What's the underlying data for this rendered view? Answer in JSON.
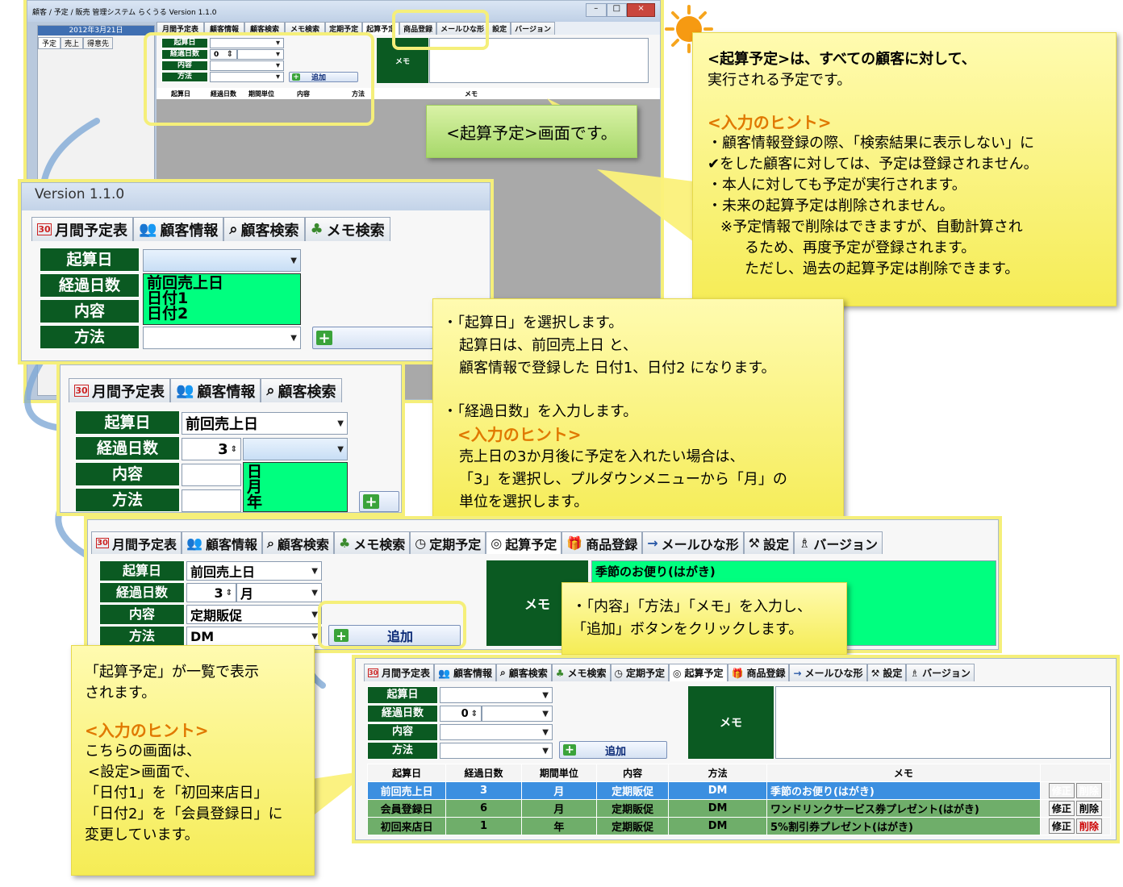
{
  "window": {
    "title": "顧客 / 予定 / 販売 管理システム らくうる Version 1.1.0",
    "date": "2012年3月21日",
    "side_tabs": [
      "予定",
      "売上",
      "得意先"
    ]
  },
  "tabs": [
    "月間予定表",
    "顧客情報",
    "顧客検索",
    "メモ検索",
    "定期予定",
    "起算予定",
    "商品登録",
    "メールひな形",
    "設定",
    "バージョン"
  ],
  "form": {
    "label_base_date": "起算日",
    "label_elapsed": "経過日数",
    "label_content": "内容",
    "label_method": "方法",
    "add_button": "追加",
    "memo_label": "メモ"
  },
  "top_screen": {
    "elapsed_value": "0",
    "columns": [
      "起算日",
      "経過日数",
      "期間単位",
      "内容",
      "方法",
      "メモ"
    ]
  },
  "zoom1": {
    "version": "Version 1.1.0",
    "dropdown_options": [
      "前回売上日",
      "日付1",
      "日付2"
    ]
  },
  "zoom2": {
    "base_date_value": "前回売上日",
    "elapsed_value": "3",
    "unit_options": [
      "日",
      "月",
      "年"
    ]
  },
  "zoom3": {
    "base_date_value": "前回売上日",
    "elapsed_value": "3",
    "unit_value": "月",
    "content_value": "定期販促",
    "method_value": "DM",
    "memo_text": "季節のお便り(はがき)"
  },
  "bottom_screen": {
    "elapsed_value": "0",
    "columns": [
      "起算日",
      "経過日数",
      "期間単位",
      "内容",
      "方法",
      "メモ"
    ],
    "rows": [
      {
        "base": "前回売上日",
        "days": "3",
        "unit": "月",
        "content": "定期販促",
        "method": "DM",
        "memo": "季節のお便り(はがき)"
      },
      {
        "base": "会員登録日",
        "days": "6",
        "unit": "月",
        "content": "定期販促",
        "method": "DM",
        "memo": "ワンドリンクサービス券プレゼント(はがき)"
      },
      {
        "base": "初回来店日",
        "days": "1",
        "unit": "年",
        "content": "定期販促",
        "method": "DM",
        "memo": "5%割引券プレゼント(はがき)"
      }
    ],
    "edit_label": "修正",
    "delete_label": "削除"
  },
  "callouts": {
    "screen_label": "<起算予定>画面です。",
    "main_note": {
      "line1": "<起算予定>は、すべての顧客に対して、",
      "line2": "実行される予定です。",
      "hint_title": "<入力のヒント>",
      "line3": "・顧客情報登録の際、「検索結果に表示しない」に",
      "line4": "✔をした顧客に対しては、予定は登録されません。",
      "line5": "・本人に対しても予定が実行されます。",
      "line6": "・未来の起算予定は削除されません。",
      "line7": "※予定情報で削除はできますが、自動計算され",
      "line8": "るため、再度予定が登録されます。",
      "line9": "ただし、過去の起算予定は削除できます。"
    },
    "step_note": {
      "line1": "・「起算日」を選択します。",
      "line2": "起算日は、前回売上日 と、",
      "line3": "顧客情報で登録した 日付1、日付2 になります。",
      "line4": "・「経過日数」を入力します。",
      "hint_title": "<入力のヒント>",
      "line5": "売上日の3か月後に予定を入れたい場合は、",
      "line6": "「3」を選択し、プルダウンメニューから「月」の",
      "line7": "単位を選択します。"
    },
    "add_note": {
      "line1": "・「内容」「方法」「メモ」を入力し、",
      "line2": "「追加」ボタンをクリックします。"
    },
    "list_note": {
      "line1": "「起算予定」が一覧で表示",
      "line2": "されます。",
      "hint_title": "<入力のヒント>",
      "line3": "こちらの画面は、",
      "line4": "<設定>画面で、",
      "line5": "「日付1」を「初回来店日」",
      "line6": "「日付2」を「会員登録日」に",
      "line7": "変更しています。"
    }
  },
  "colors": {
    "label_green": "#0b5a22",
    "dropdown_green": "#00ff7f",
    "note_yellow": "#fff56a",
    "hint_orange": "#e07800",
    "selected_row": "#3b8fe0",
    "row_green": "#6fae6a"
  }
}
